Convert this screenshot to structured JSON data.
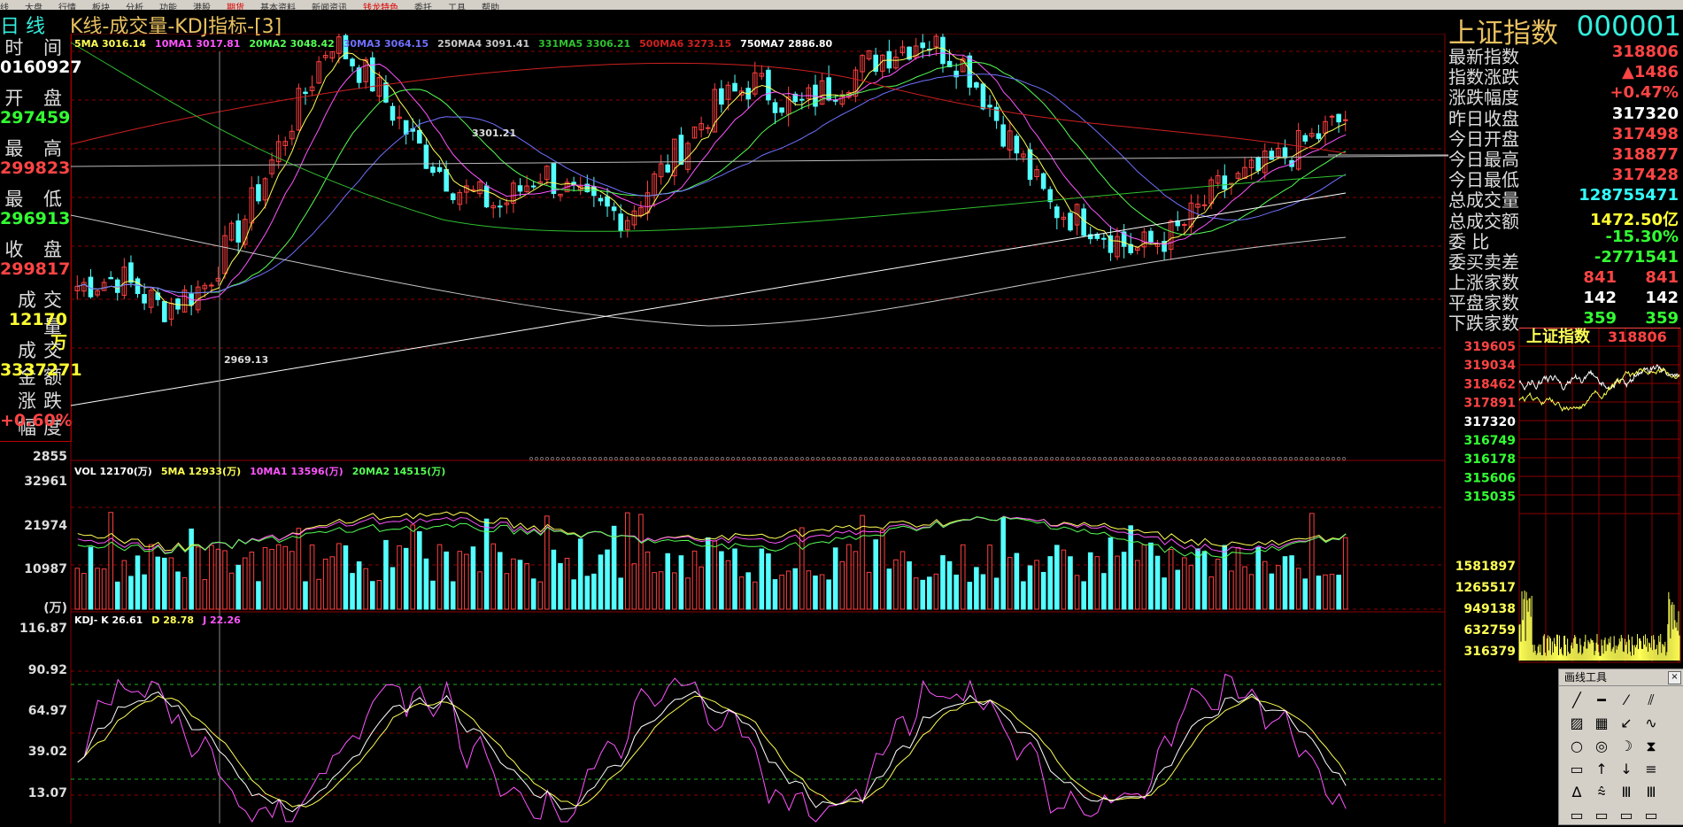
{
  "menu": {
    "items": [
      "线",
      "大盘",
      "行情",
      "板块",
      "分析",
      "功能",
      "港股",
      "期货",
      "基本资料",
      "新闻资讯",
      "钱龙特色",
      "委托",
      "工具",
      "帮助"
    ],
    "highlight_index": [
      7,
      10
    ]
  },
  "title": {
    "period": "日 线",
    "indicator": "K线-成交量-KDJ指标-[3]"
  },
  "left_panel": {
    "rows": [
      {
        "label": "时 间",
        "value": "0160927",
        "color": "#ffffff"
      },
      {
        "label": "开 盘",
        "value": "297459",
        "color": "#3f3"
      },
      {
        "label": "最 高",
        "value": "299823",
        "color": "#f44"
      },
      {
        "label": "最 低",
        "value": "296913",
        "color": "#3f3"
      },
      {
        "label": "收 盘",
        "value": "299817",
        "color": "#f44"
      },
      {
        "label": "成交量",
        "value": "12170万",
        "color": "#ff3"
      },
      {
        "label": "成交金额",
        "value": "3337271",
        "color": "#ff3"
      },
      {
        "label": "涨跌幅度",
        "value": "+0.60%",
        "color": "#f44"
      }
    ],
    "bottom_axis": "2855"
  },
  "ma_legend": [
    {
      "text": "5MA 3016.14",
      "color": "#ffff55"
    },
    {
      "text": "10MA1 3017.81",
      "color": "#ff55ff"
    },
    {
      "text": "20MA2 3048.42",
      "color": "#55ff55"
    },
    {
      "text": "30MA3 3064.15",
      "color": "#7070ff"
    },
    {
      "text": "250MA4 3091.41",
      "color": "#c8c8c8"
    },
    {
      "text": "331MA5 3306.21",
      "color": "#30c030"
    },
    {
      "text": "500MA6 3273.15",
      "color": "#d02020"
    },
    {
      "text": "750MA7 2886.80",
      "color": "#ffffff"
    }
  ],
  "price_annotations": {
    "high": "3301.21",
    "low": "2969.13"
  },
  "vol_legend": [
    {
      "text": "VOL 12170(万)",
      "color": "#ffffff"
    },
    {
      "text": "5MA 12933(万)",
      "color": "#ffff55"
    },
    {
      "text": "10MA1 13596(万)",
      "color": "#ff55ff"
    },
    {
      "text": "20MA2 14515(万)",
      "color": "#55ff55"
    }
  ],
  "vol_axis": [
    "32961",
    "21974",
    "10987",
    "(万)"
  ],
  "kdj_legend": [
    {
      "text": "KDJ- K 26.61",
      "color": "#ffffff"
    },
    {
      "text": "D 28.78",
      "color": "#ffff55"
    },
    {
      "text": "J 22.26",
      "color": "#ff55ff"
    }
  ],
  "kdj_axis": [
    "116.87",
    "90.92",
    "64.97",
    "39.02",
    "13.07"
  ],
  "right_panel": {
    "index_name": "上证指数",
    "index_code": "000001",
    "quotes": [
      {
        "label": "最新指数",
        "value": "318806",
        "color": "#f44"
      },
      {
        "label": "指数涨跌",
        "value": "▲1486",
        "color": "#f44"
      },
      {
        "label": "涨跌幅度",
        "value": "+0.47%",
        "color": "#f44"
      },
      {
        "label": "昨日收盘",
        "value": "317320",
        "color": "#ffffff"
      },
      {
        "label": "今日开盘",
        "value": "317498",
        "color": "#f44"
      },
      {
        "label": "今日最高",
        "value": "318877",
        "color": "#f44"
      },
      {
        "label": "今日最低",
        "value": "317428",
        "color": "#f44"
      },
      {
        "label": "总成交量",
        "value": "128755471",
        "color": "#3ff"
      },
      {
        "label": "总成交额",
        "value": "1472.50亿",
        "color": "#ff3"
      },
      {
        "label": "委 比",
        "value": "-15.30%",
        "color": "#3f3"
      },
      {
        "label": "委买卖差",
        "value": "-2771541",
        "color": "#3f3"
      }
    ],
    "breadth": [
      {
        "label": "上涨家数",
        "v1": "841",
        "v2": "841",
        "color": "#f44"
      },
      {
        "label": "平盘家数",
        "v1": "142",
        "v2": "142",
        "color": "#ffffff"
      },
      {
        "label": "下跌家数",
        "v1": "359",
        "v2": "359",
        "color": "#3f3"
      }
    ],
    "mini_title": "上证指数",
    "mini_value": "318806",
    "mini_price_axis": [
      {
        "v": "319605",
        "c": "#f44"
      },
      {
        "v": "319034",
        "c": "#f44"
      },
      {
        "v": "318462",
        "c": "#f44"
      },
      {
        "v": "317891",
        "c": "#f44"
      },
      {
        "v": "317320",
        "c": "#ffffff"
      },
      {
        "v": "316749",
        "c": "#3f3"
      },
      {
        "v": "316178",
        "c": "#3f3"
      },
      {
        "v": "315606",
        "c": "#3f3"
      },
      {
        "v": "315035",
        "c": "#3f3"
      }
    ],
    "mini_vol_axis": [
      "1581897",
      "1265517",
      "949138",
      "632759",
      "316379"
    ]
  },
  "toolbox": {
    "title": "画线工具",
    "close": "×",
    "tools": [
      "╱",
      "━",
      "⁄",
      "⫽",
      "▨",
      "▦",
      "↙",
      "∿",
      "○",
      "◎",
      "☽",
      "⧗",
      "▭",
      "↑",
      "↓",
      "≡",
      "∆",
      "⩯",
      "Ⅲ",
      "Ⅲ",
      "▭",
      "▭",
      "▭",
      "▭"
    ]
  },
  "colors": {
    "grid": "#8b0000",
    "up": "#ff4040",
    "down": "#54ffff",
    "kdj_k": "#ffffff",
    "kdj_d": "#ffff55",
    "kdj_j": "#ff55ff"
  }
}
